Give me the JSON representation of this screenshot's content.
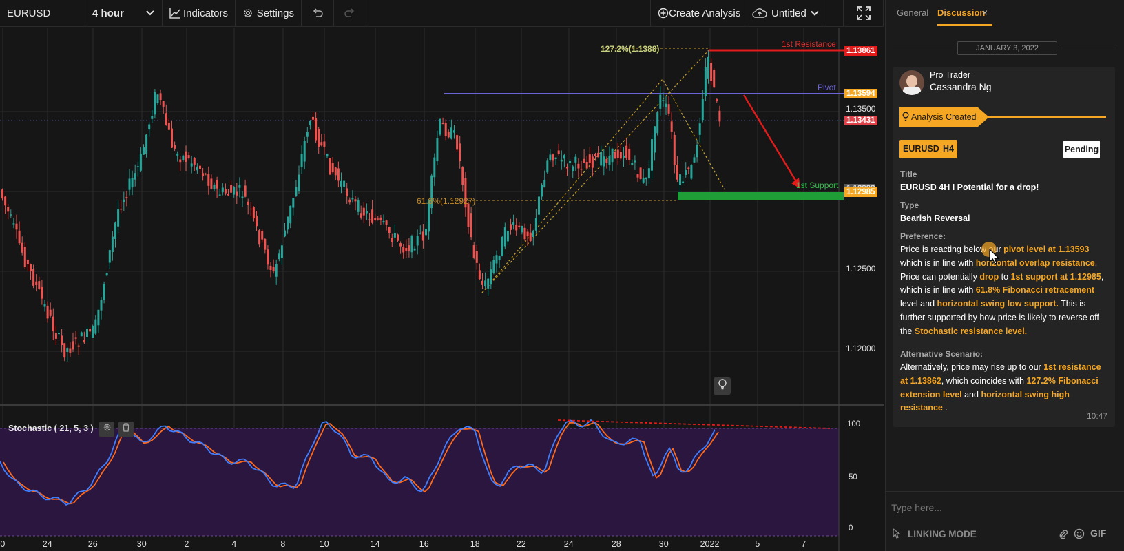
{
  "toolbar": {
    "symbol": "EURUSD",
    "timeframe": "4 hour",
    "indicators_label": "Indicators",
    "settings_label": "Settings",
    "create_analysis_label": "Create Analysis",
    "layout_name": "Untitled"
  },
  "chart": {
    "price_axis": [
      "1.13500",
      "1.12500",
      "1.12000"
    ],
    "price_tags": {
      "resistance": "1.13861",
      "pivot": "1.13594",
      "current": "1.13431",
      "support": "1.12985",
      "support_hidden": "1.12998"
    },
    "labels": {
      "resistance": "1st Resistance",
      "pivot": "Pivot",
      "support": "1st Support",
      "fib_ext": "127.2%(1.1388)",
      "fib_ret": "61.8%(1.12927)"
    },
    "time_axis": [
      "0",
      "24",
      "26",
      "30",
      "2",
      "4",
      "8",
      "10",
      "14",
      "16",
      "18",
      "22",
      "24",
      "28",
      "30",
      "2022",
      "5",
      "7"
    ],
    "stochastic_label": "Stochastic ( 21, 5, 3 )",
    "stochastic_axis": [
      "100",
      "50",
      "0"
    ],
    "colors": {
      "bull": "#26a69a",
      "bear": "#ef5350",
      "pivot": "#6b63d6",
      "resistance": "#e21b1b",
      "support": "#1f9d36",
      "k_line": "#3f7fff",
      "d_line": "#ff6a1a"
    }
  },
  "panel": {
    "tabs": [
      "General",
      "Discussion"
    ],
    "close_icon": "×",
    "date": "JANUARY 3, 2022",
    "author_role": "Pro Trader",
    "author_name": "Cassandra Ng",
    "event": "Analysis Created",
    "symbol_chip": "EURUSD",
    "timeframe_chip": "H4",
    "status": "Pending",
    "title_label": "Title",
    "title_value": "EURUSD 4H I Potential for a drop!",
    "type_label": "Type",
    "type_value": "Bearish Reversal",
    "preference_label": "Preference:",
    "preference_segments": [
      {
        "t": "Price is reacting below our ",
        "h": false
      },
      {
        "t": "pivot level at 1.13593",
        "h": true
      },
      {
        "t": " which is in line with ",
        "h": false
      },
      {
        "t": "horizontal overlap resistance",
        "h": true
      },
      {
        "t": ". Price can potentially ",
        "h": false
      },
      {
        "t": "drop",
        "h": true
      },
      {
        "t": " to ",
        "h": false
      },
      {
        "t": "1st support at 1.12985",
        "h": true
      },
      {
        "t": ", which is in line with ",
        "h": false
      },
      {
        "t": "61.8% Fibonacci retracement",
        "h": true
      },
      {
        "t": " level and ",
        "h": false
      },
      {
        "t": "horizontal swing low support.",
        "h": true
      },
      {
        "t": "  This is further supported by how price is likely to reverse off the ",
        "h": false
      },
      {
        "t": "Stochastic resistance level.",
        "h": true
      }
    ],
    "alt_label": "Alternative Scenario:",
    "alt_segments": [
      {
        "t": "Alternatively, price may rise up to our ",
        "h": false
      },
      {
        "t": "1st resistance at 1.13862",
        "h": true
      },
      {
        "t": ", which coincides with ",
        "h": false
      },
      {
        "t": "127.2% Fibonacci extension level",
        "h": true
      },
      {
        "t": " and ",
        "h": false
      },
      {
        "t": "horizontal swing high resistance",
        "h": true
      },
      {
        "t": " .",
        "h": false
      }
    ],
    "time": "10:47",
    "composer_placeholder": "Type here...",
    "linking_mode": "LINKING MODE",
    "gif_label": "GIF"
  }
}
